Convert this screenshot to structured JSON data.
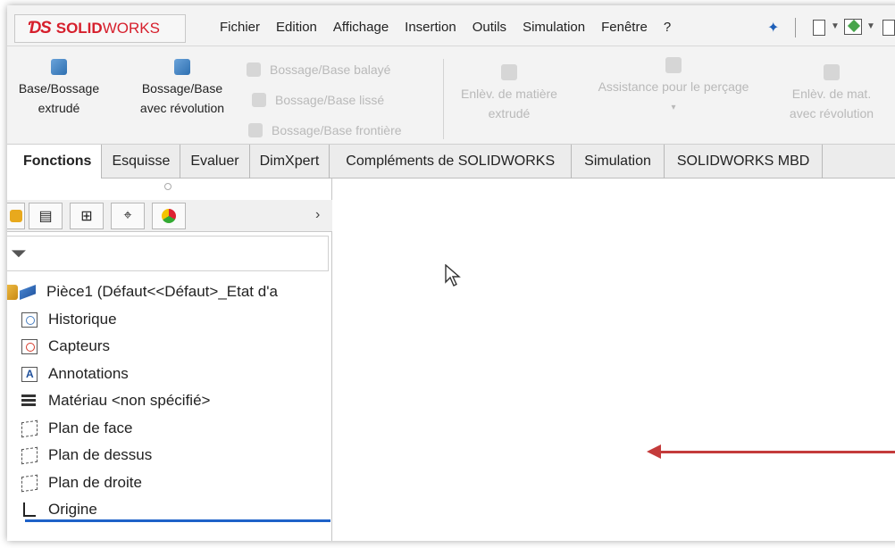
{
  "app": {
    "logo_ds": "ƊS",
    "logo_solid": "SOLID",
    "logo_works": "WORKS"
  },
  "menu": [
    "Fichier",
    "Edition",
    "Affichage",
    "Insertion",
    "Outils",
    "Simulation",
    "Fenêtre",
    "?"
  ],
  "ribbon": {
    "extrude": [
      "Base/Bossage",
      "extrudé"
    ],
    "revolve": [
      "Bossage/Base",
      "avec révolution"
    ],
    "swept": "Bossage/Base balayé",
    "loft": "Bossage/Base lissé",
    "boundary": "Bossage/Base frontière",
    "cut_extrude": [
      "Enlèv. de matière",
      "extrudé"
    ],
    "hole_wizard": "Assistance pour le perçage",
    "cut_revolve": [
      "Enlèv. de mat.",
      "avec révolution"
    ]
  },
  "tabs": [
    "Fonctions",
    "Esquisse",
    "Evaluer",
    "DimXpert",
    "Compléments de SOLIDWORKS",
    "Simulation",
    "SOLIDWORKS MBD"
  ],
  "panel": {
    "chevron": "›",
    "filter_icon": "funnel-icon"
  },
  "tree": {
    "root": "Pièce1  (Défaut<<Défaut>_Etat d'a",
    "items": [
      "Historique",
      "Capteurs",
      "Annotations",
      "Matériau <non spécifié>",
      "Plan de face",
      "Plan de dessus",
      "Plan de droite",
      "Origine"
    ]
  },
  "colors": {
    "brand": "#d61f2c",
    "arrow": "#c43b3b",
    "selection_line": "#1e62c8"
  }
}
